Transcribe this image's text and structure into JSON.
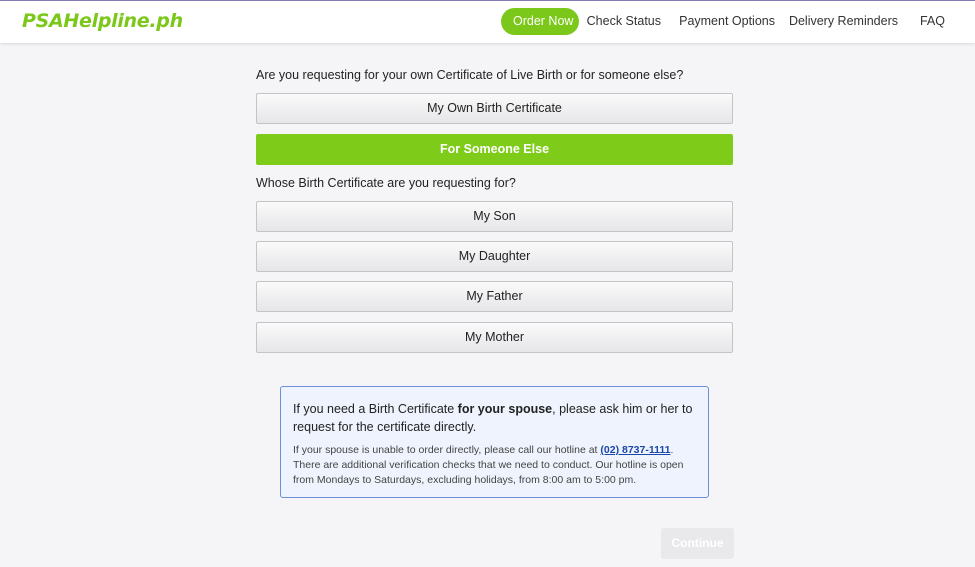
{
  "header": {
    "logo": "PSAHelpline.ph",
    "nav": {
      "order_now": "Order Now",
      "check_status": "Check Status",
      "payment_options": "Payment Options",
      "delivery_reminders": "Delivery Reminders",
      "faq": "FAQ"
    }
  },
  "question1": {
    "label": "Are you requesting for your own Certificate of Live Birth or for someone else?",
    "options": [
      "My Own Birth Certificate",
      "For Someone Else"
    ],
    "selected": "For Someone Else"
  },
  "question2": {
    "label": "Whose Birth Certificate are you requesting for?",
    "options": [
      "My Son",
      "My Daughter",
      "My Father",
      "My Mother"
    ]
  },
  "info": {
    "main_prefix": "If you need a Birth Certificate ",
    "main_bold": "for your spouse",
    "main_suffix": ", please ask him or her to request for the certificate directly.",
    "sub_prefix": "If your spouse is unable to order directly, please call our hotline at ",
    "hotline": "(02) 8737-1111",
    "sub_suffix": ". There are additional verification checks that we need to conduct. Our hotline is open from Mondays to Saturdays, excluding holidays, from 8:00 am to 5:00 pm."
  },
  "continue_label": "Continue",
  "colors": {
    "brand_green": "#7cc81a",
    "info_border": "#6c8fdc",
    "info_background": "#eef3fd",
    "hotline_link": "#1a47a8"
  }
}
